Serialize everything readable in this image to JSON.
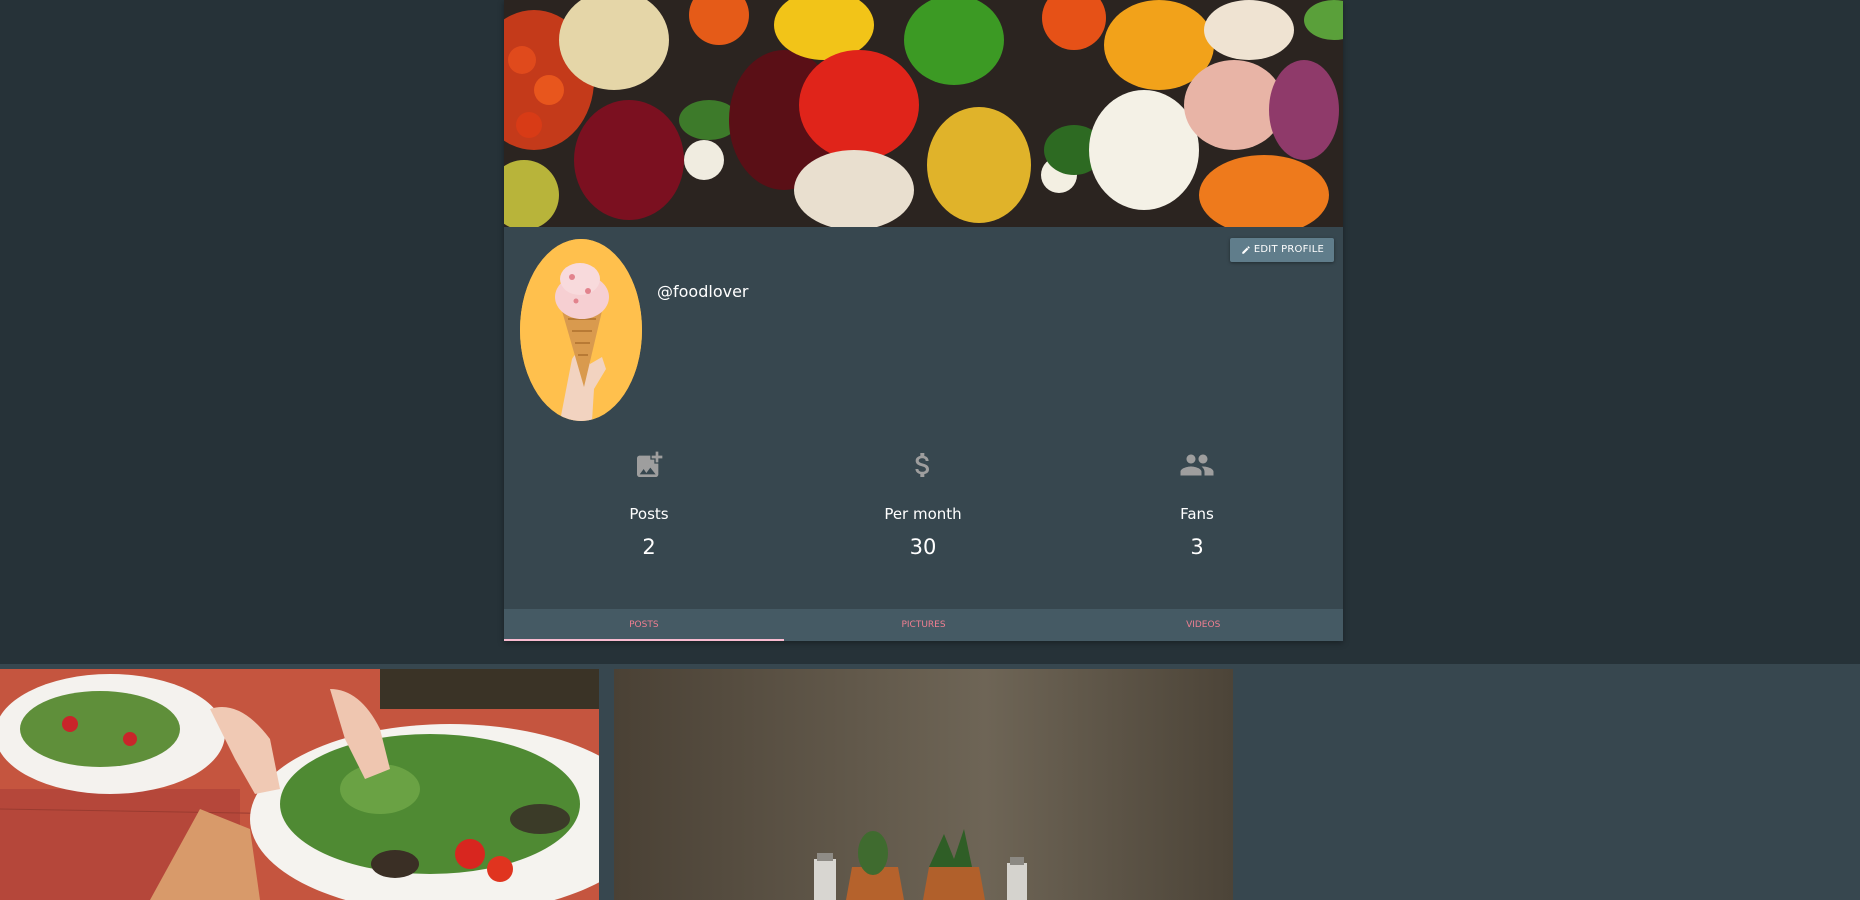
{
  "profile": {
    "username": "@foodlover",
    "edit_button_label": "EDIT PROFILE"
  },
  "stats": [
    {
      "icon": "image-icon",
      "label": "Posts",
      "value": "2"
    },
    {
      "icon": "dollar-icon",
      "label": "Per month",
      "value": "30"
    },
    {
      "icon": "group-icon",
      "label": "Fans",
      "value": "3"
    }
  ],
  "tabs": [
    {
      "label": "POSTS",
      "active": true
    },
    {
      "label": "PICTURES",
      "active": false
    },
    {
      "label": "VIDEOS",
      "active": false
    }
  ],
  "colors": {
    "background": "#263238",
    "card": "#37474f",
    "tab_bar": "#455a64",
    "tab_text": "#ef7f91",
    "button": "#607d8b"
  }
}
